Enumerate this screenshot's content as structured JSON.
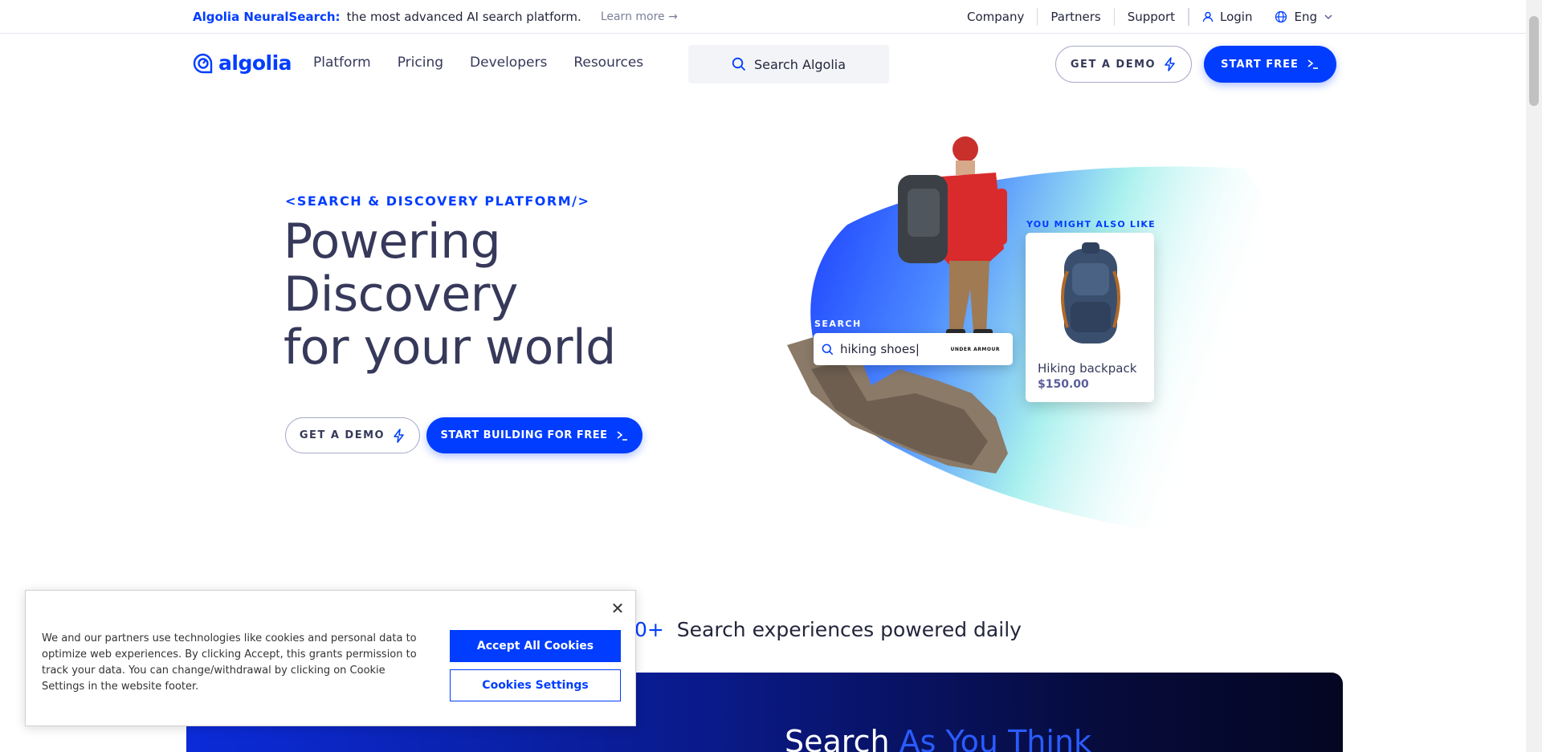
{
  "announcement": {
    "brand": "Algolia NeuralSearch:",
    "text": "the most advanced AI search platform.",
    "link": "Learn more →"
  },
  "utility_nav": {
    "links": [
      "Company",
      "Partners",
      "Support"
    ],
    "login": "Login",
    "language": "Eng"
  },
  "header": {
    "logo_text": "algolia",
    "nav": [
      "Platform",
      "Pricing",
      "Developers",
      "Resources"
    ],
    "search_placeholder": "Search Algolia",
    "demo_label": "GET A DEMO",
    "start_label": "START FREE"
  },
  "hero": {
    "eyebrow": "<SEARCH & DISCOVERY PLATFORM/>",
    "title_lines": [
      "Powering",
      "Discovery",
      "for your world"
    ],
    "demo_label": "GET A DEMO",
    "start_label": "START BUILDING FOR FREE"
  },
  "hero_art": {
    "search_label": "SEARCH",
    "search_query": "hiking shoes|",
    "brand_mark": "UNDER ARMOUR",
    "also_like_label": "YOU MIGHT ALSO LIKE",
    "product_name": "Hiking backpack",
    "product_price": "$150.00"
  },
  "stats": {
    "number_fragment": "0+",
    "text": "Search experiences powered daily"
  },
  "banner": {
    "title_plain": "Search ",
    "title_accent": "As You Think"
  },
  "cookie": {
    "text": "We and our partners use technologies like cookies and personal data to optimize web experiences. By clicking Accept, this grants permission to track your data. You can change/withdrawal by clicking on Cookie Settings in the website footer.",
    "accept_label": "Accept All Cookies",
    "settings_label": "Cookies Settings",
    "close_glyph": "✕"
  },
  "colors": {
    "brand_blue": "#003dff",
    "text_dark": "#23263b",
    "text_muted": "#36395a"
  }
}
